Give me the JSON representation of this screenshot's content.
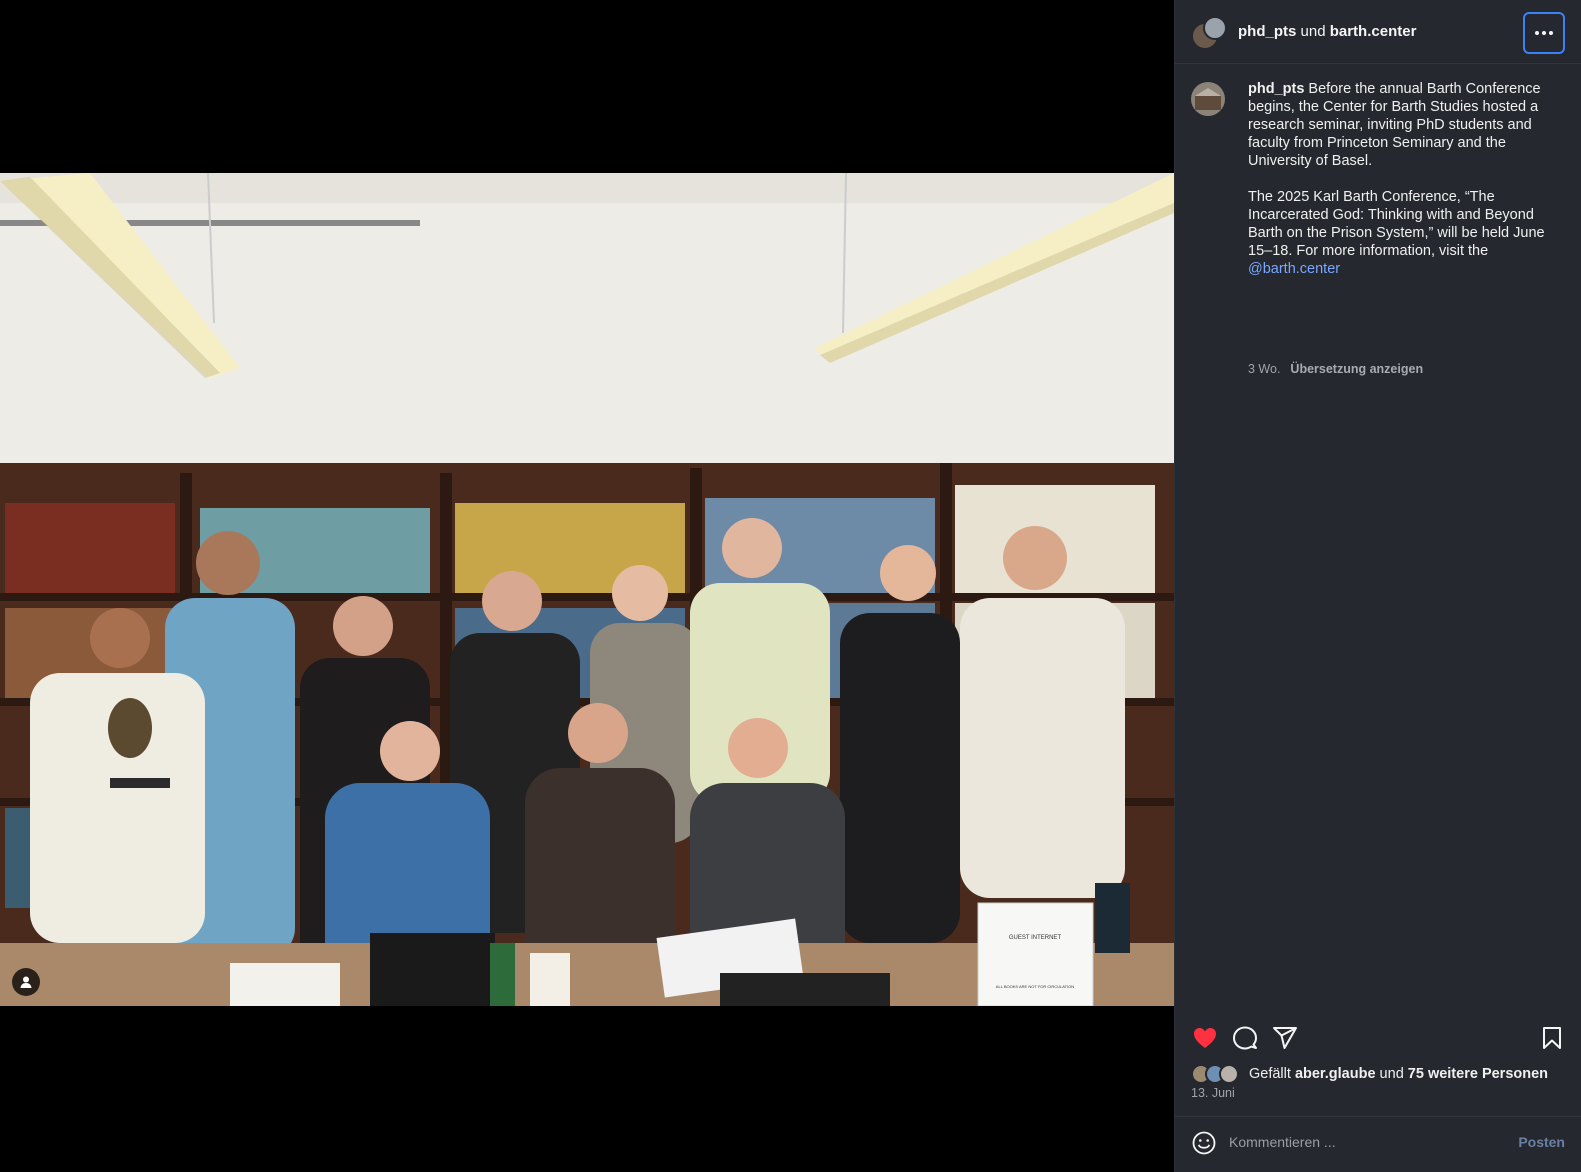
{
  "header": {
    "user1": "phd_pts",
    "connector": " und ",
    "user2": "barth.center"
  },
  "caption": {
    "username": "phd_pts",
    "paragraph1": "Before the annual Barth Conference begins, the Center for Barth Studies hosted a research seminar, inviting PhD students and faculty from Princeton Seminary and the University of Basel.",
    "paragraph2": "The 2025 Karl Barth Conference, “The Incarcerated God: Thinking with and Beyond Barth on the Prison System,” will be held June 15–18. For more information, visit the",
    "mention": "@barth.center",
    "age": "3 Wo.",
    "translate": "Übersetzung anzeigen"
  },
  "likes": {
    "prefix": "Gefällt ",
    "user": "aber.glaube",
    "connector": " und ",
    "count": "75 weitere Personen"
  },
  "date": "13. Juni",
  "comment": {
    "placeholder": "Kommentieren ...",
    "post_label": "Posten"
  },
  "photo_sign": {
    "title": "GUEST INTERNET",
    "note": "ALL BOOKS ARE NOT FOR CIRCULATION"
  },
  "colors": {
    "panel_bg": "#25282e",
    "like_red": "#ff3040",
    "mention_blue": "#7aa7ff",
    "focus_blue": "#3b82f6"
  },
  "icons": {
    "like": "heart-icon",
    "comment": "comment-icon",
    "share": "share-icon",
    "save": "bookmark-icon",
    "more": "more-icon",
    "emoji": "emoji-icon",
    "tag": "user-tag-icon"
  }
}
